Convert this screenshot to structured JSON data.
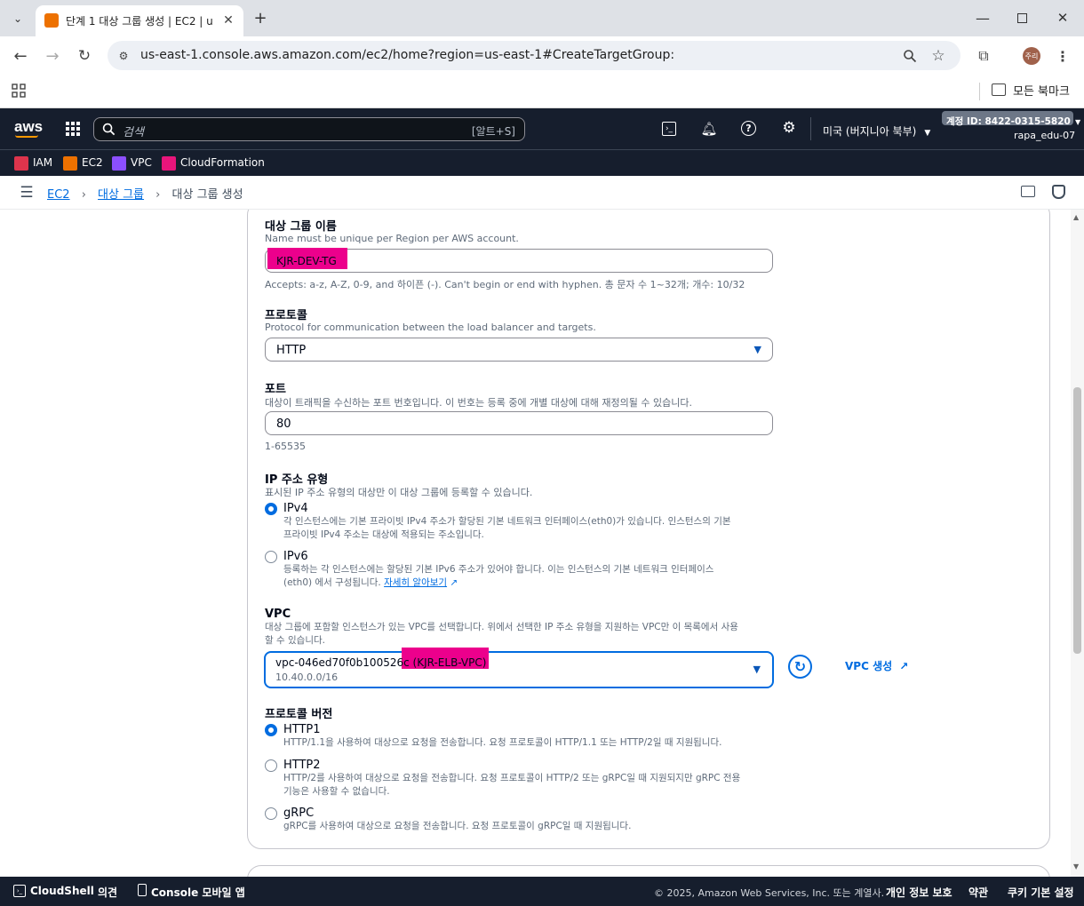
{
  "browser": {
    "tab_title": "단계 1 대상 그룹 생성 | EC2 | u",
    "url": "us-east-1.console.aws.amazon.com/ec2/home?region=us-east-1#CreateTargetGroup:",
    "profile_label": "주리",
    "bookmarks_label": "모든 북마크"
  },
  "aws_header": {
    "logo": "aws",
    "search_placeholder": "검색",
    "search_shortcut": "[알트+S]",
    "region": "미국 (버지니아 북부)",
    "account_id_label": "계정 ID: 8422-0315-5820",
    "user": "rapa_edu-07"
  },
  "favorites": [
    {
      "label": "IAM",
      "color": "#dd344c"
    },
    {
      "label": "EC2",
      "color": "#ed7100"
    },
    {
      "label": "VPC",
      "color": "#8c4fff"
    },
    {
      "label": "CloudFormation",
      "color": "#e7157b"
    }
  ],
  "breadcrumb": {
    "item1": "EC2",
    "item2": "대상 그룹",
    "current": "대상 그룹 생성"
  },
  "form": {
    "name": {
      "label": "대상 그룹 이름",
      "desc": "Name must be unique per Region per AWS account.",
      "value": "KJR-DEV-TG",
      "hint": "Accepts: a-z, A-Z, 0-9, and 하이픈 (-). Can't begin or end with hyphen. 총 문자 수 1~32개; 개수: 10/32"
    },
    "protocol": {
      "label": "프로토콜",
      "desc": "Protocol for communication between the load balancer and targets.",
      "value": "HTTP"
    },
    "port": {
      "label": "포트",
      "desc": "대상이 트래픽을 수신하는 포트 번호입니다. 이 번호는 등록 중에 개별 대상에 대해 재정의될 수 있습니다.",
      "value": "80",
      "hint": "1-65535"
    },
    "ip_type": {
      "label": "IP 주소 유형",
      "desc": "표시된 IP 주소 유형의 대상만 이 대상 그룹에 등록할 수 있습니다.",
      "ipv4_label": "IPv4",
      "ipv4_desc1": "각 인스턴스에는 기본 프라이빗 IPv4 주소가 할당된 기본 네트워크 인터페이스(eth0)가 있습니다. 인스턴스의 기본",
      "ipv4_desc2": "프라이빗 IPv4 주소는 대상에 적용되는 주소입니다.",
      "ipv6_label": "IPv6",
      "ipv6_desc1": "등록하는 각 인스턴스에는 할당된 기본 IPv6 주소가 있어야 합니다. 이는 인스턴스의 기본 네트워크 인터페이스",
      "ipv6_desc2": "(eth0) 에서 구성됩니다.",
      "learn_more": "자세히 알아보기",
      "selected": "IPv4"
    },
    "vpc": {
      "label": "VPC",
      "desc1": "대상 그룹에 포함할 인스턴스가 있는 VPC를 선택합니다. 위에서 선택한 IP 주소 유형을 지원하는 VPC만 이 목록에서 사용",
      "desc2": "할 수 있습니다.",
      "value_id": "vpc-046ed70f0b100526c",
      "value_name": "(KJR-ELB-VPC)",
      "cidr": "10.40.0.0/16",
      "create_label": "VPC 생성"
    },
    "protocol_version": {
      "label": "프로토콜 버전",
      "http1_label": "HTTP1",
      "http1_desc": "HTTP/1.1을 사용하여 대상으로 요청을 전송합니다. 요청 프로토콜이 HTTP/1.1 또는 HTTP/2일 때 지원됩니다.",
      "http2_label": "HTTP2",
      "http2_desc1": "HTTP/2를 사용하여 대상으로 요청을 전송합니다. 요청 프로토콜이 HTTP/2 또는 gRPC일 때 지원되지만 gRPC 전용",
      "http2_desc2": "기능은 사용할 수 없습니다.",
      "grpc_label": "gRPC",
      "grpc_desc": "gRPC를 사용하여 대상으로 요청을 전송합니다. 요청 프로토콜이 gRPC일 때 지원됩니다.",
      "selected": "HTTP1"
    }
  },
  "footer": {
    "cloudshell": "CloudShell",
    "feedback": "의견",
    "mobile_app": "Console 모바일 앱",
    "copyright": "© 2025, Amazon Web Services, Inc. 또는 계열사.",
    "privacy": "개인 정보 보호",
    "terms": "약관",
    "cookies": "쿠키 기본 설정"
  },
  "colors": {
    "aws_nav": "#161e2d",
    "link": "#006ce0",
    "highlight": "#ec008c"
  }
}
